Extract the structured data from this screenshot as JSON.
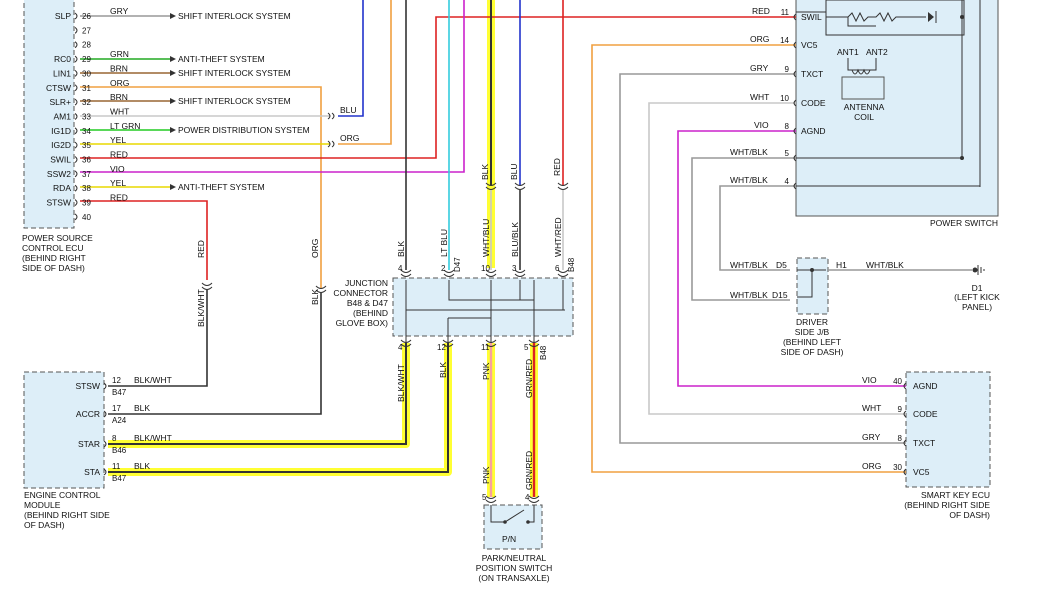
{
  "colors": {
    "module_fill": "#ddeef8",
    "frame": "#555555",
    "highlight": "#ffff33",
    "wire_black": "#333333",
    "wire_blue": "#2233cc",
    "wire_lt_blue": "#33ccdd",
    "wire_red": "#dd2222",
    "wire_orange": "#f0a040",
    "wire_violet": "#cc22cc",
    "wire_white": "#c8c8c8",
    "wire_gray": "#999999",
    "wire_green": "#22aa22",
    "wire_brown": "#996633",
    "wire_yellow": "#e8d800",
    "wire_pink": "#f8a0a0"
  },
  "power_source_ecu": {
    "label": [
      "POWER SOURCE",
      "CONTROL ECU",
      "(BEHIND RIGHT",
      "SIDE OF DASH)"
    ],
    "pins": [
      {
        "name": "SLP",
        "num": "26",
        "color": "GRY"
      },
      {
        "name": "",
        "num": "27",
        "color": ""
      },
      {
        "name": "",
        "num": "28",
        "color": ""
      },
      {
        "name": "RC0",
        "num": "29",
        "color": "GRN"
      },
      {
        "name": "LIN1",
        "num": "30",
        "color": "BRN"
      },
      {
        "name": "CTSW",
        "num": "31",
        "color": "ORG"
      },
      {
        "name": "SLR+",
        "num": "32",
        "color": "BRN"
      },
      {
        "name": "AM1",
        "num": "33",
        "color": "WHT"
      },
      {
        "name": "IG1D",
        "num": "34",
        "color": "LT GRN"
      },
      {
        "name": "IG2D",
        "num": "35",
        "color": "YEL"
      },
      {
        "name": "SWIL",
        "num": "36",
        "color": "RED"
      },
      {
        "name": "SSW2",
        "num": "37",
        "color": "VIO"
      },
      {
        "name": "RDA",
        "num": "38",
        "color": "YEL"
      },
      {
        "name": "STSW",
        "num": "39",
        "color": "RED"
      },
      {
        "name": "",
        "num": "40",
        "color": ""
      }
    ]
  },
  "systems": {
    "shift_interlock": "SHIFT INTERLOCK SYSTEM",
    "anti_theft": "ANTI-THEFT SYSTEM",
    "power_distribution": "POWER DISTRIBUTION SYSTEM"
  },
  "mid_wires": {
    "blu": "BLU",
    "org": "ORG",
    "red": "RED",
    "orgv": "ORG",
    "blk_wht": "BLK/WHT",
    "blk": "BLK"
  },
  "junction": {
    "label": [
      "JUNCTION",
      "CONNECTOR",
      "B48 & D47",
      "(BEHIND",
      "GLOVE BOX)"
    ],
    "top_wires": [
      {
        "color": "BLK",
        "pin": "4"
      },
      {
        "color": "LT BLU",
        "pin": "2"
      },
      {
        "color": "WHT/BLU",
        "pin": "10"
      },
      {
        "color": "BLU/BLK",
        "pin": "3"
      },
      {
        "color": "WHT/RED",
        "pin": "6"
      }
    ],
    "top_conn_d47": "D47",
    "top_conn_b48": "B48",
    "above_wires": [
      "BLK",
      "BLU",
      "RED"
    ],
    "bottom_wires": [
      {
        "color": "BLK/WHT",
        "pin": "4"
      },
      {
        "color": "BLK",
        "pin": "12"
      },
      {
        "color": "PNK",
        "pin": "11"
      },
      {
        "color": "GRN/RED",
        "pin": "5"
      }
    ],
    "bottom_conn_b48": "B48"
  },
  "engine_ecm": {
    "label": [
      "ENGINE CONTROL",
      "MODULE",
      "(BEHIND RIGHT SIDE",
      "OF DASH)"
    ],
    "pins": [
      {
        "name": "STSW",
        "num": "12",
        "color": "BLK/WHT",
        "conn": "B47"
      },
      {
        "name": "ACCR",
        "num": "17",
        "color": "BLK",
        "conn": "A24"
      },
      {
        "name": "STAR",
        "num": "8",
        "color": "BLK/WHT",
        "conn": "B46"
      },
      {
        "name": "STA",
        "num": "11",
        "color": "BLK",
        "conn": "B47"
      }
    ]
  },
  "park_neutral": {
    "label": [
      "PARK/NEUTRAL",
      "POSITION SWITCH",
      "(ON TRANSAXLE)"
    ],
    "inner": "P/N",
    "pins": [
      {
        "num": "5",
        "color": "PNK"
      },
      {
        "num": "4",
        "color": "GRN/RED"
      }
    ]
  },
  "power_switch": {
    "label": "POWER SWITCH",
    "pins": [
      {
        "name": "SWIL",
        "num": "11",
        "color": "RED"
      },
      {
        "name": "VC5",
        "num": "14",
        "color": "ORG"
      },
      {
        "name": "TXCT",
        "num": "9",
        "color": "GRY"
      },
      {
        "name": "CODE",
        "num": "10",
        "color": "WHT"
      },
      {
        "name": "AGND",
        "num": "8",
        "color": "VIO"
      },
      {
        "name": "",
        "num": "5",
        "color": "WHT/BLK"
      },
      {
        "name": "",
        "num": "4",
        "color": "WHT/BLK"
      }
    ],
    "antenna": [
      "ANT1",
      "ANT2"
    ],
    "coil": [
      "ANTENNA",
      "COIL"
    ]
  },
  "driver_jb": {
    "label": [
      "DRIVER",
      "SIDE J/B",
      "(BEHIND LEFT",
      "SIDE OF DASH)"
    ],
    "rows": [
      {
        "color": "WHT/BLK",
        "pin": "D5"
      },
      {
        "color": "WHT/BLK",
        "pin": "D15"
      }
    ],
    "out_pin": "H1",
    "out_color": "WHT/BLK"
  },
  "ground": {
    "name": "D1",
    "label": [
      "(LEFT KICK",
      "PANEL)"
    ]
  },
  "smart_key": {
    "label": [
      "SMART KEY ECU",
      "(BEHIND RIGHT SIDE",
      "OF DASH)"
    ],
    "pins": [
      {
        "name": "AGND",
        "num": "40",
        "color": "VIO"
      },
      {
        "name": "CODE",
        "num": "9",
        "color": "WHT"
      },
      {
        "name": "TXCT",
        "num": "8",
        "color": "GRY"
      },
      {
        "name": "VC5",
        "num": "30",
        "color": "ORG"
      }
    ]
  }
}
